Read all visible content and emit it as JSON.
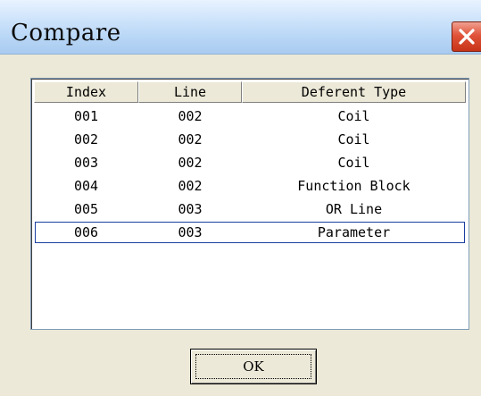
{
  "dialog": {
    "title": "Compare",
    "ok_label": "OK"
  },
  "columns": [
    "Index",
    "Line",
    "Deferent Type"
  ],
  "rows": [
    {
      "index": "001",
      "line": "002",
      "type": "Coil"
    },
    {
      "index": "002",
      "line": "002",
      "type": "Coil"
    },
    {
      "index": "003",
      "line": "002",
      "type": "Coil"
    },
    {
      "index": "004",
      "line": "002",
      "type": "Function Block"
    },
    {
      "index": "005",
      "line": "003",
      "type": "OR Line"
    },
    {
      "index": "006",
      "line": "003",
      "type": "Parameter"
    }
  ],
  "selected_row_index": 5,
  "icons": {
    "close": "close-icon"
  },
  "colors": {
    "title_bar": "#b8d6f6",
    "client_background": "#ece9d8",
    "close_button": "#e0533a",
    "selection_outline": "#1a3fa0"
  }
}
